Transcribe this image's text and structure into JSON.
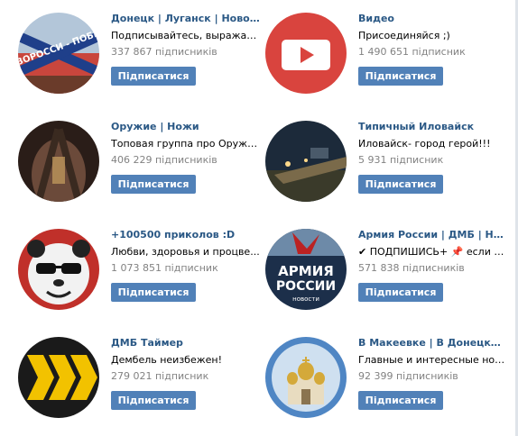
{
  "button_label": "Підписатися",
  "groups": [
    {
      "name": "Донецк | Луганск | Новоро...",
      "desc": "Подписывайтесь, выражай...",
      "subs": "337 867 підписників",
      "avatar_text": "НОВОРОССИ - ПОБЕДА"
    },
    {
      "name": "Видео",
      "desc": "Присоединяйся ;)",
      "subs": "1 490 651 підписник"
    },
    {
      "name": "Оружие | Ножи",
      "desc": "Топовая группа про Оружи...",
      "subs": "406 229 підписників"
    },
    {
      "name": "Типичный Иловайск",
      "desc": "Иловайск- город герой!!!",
      "subs": "5 931 підписник"
    },
    {
      "name": "+100500 приколов :D",
      "desc": "Любви, здоровья и процве...",
      "subs": "1 073 851 підписник"
    },
    {
      "name": "Армия России | ДМБ | Нов...",
      "desc": "✔ ПОДПИШИСЬ+ 📌 если х...",
      "subs": "571 838 підписників",
      "avatar_text": "АРМИЯ РОССИИ новости"
    },
    {
      "name": "ДМБ Таймер",
      "desc": "Дембель неизбежен!",
      "subs": "279 021 підписник"
    },
    {
      "name": "В Макеевке | В Донецке | Н...",
      "desc": "Главные и интересные нов...",
      "subs": "92 399 підписників"
    }
  ],
  "colors": {
    "link": "#2a5885",
    "button": "#5181b8",
    "muted": "#828282",
    "youtube_red": "#d9443e"
  }
}
